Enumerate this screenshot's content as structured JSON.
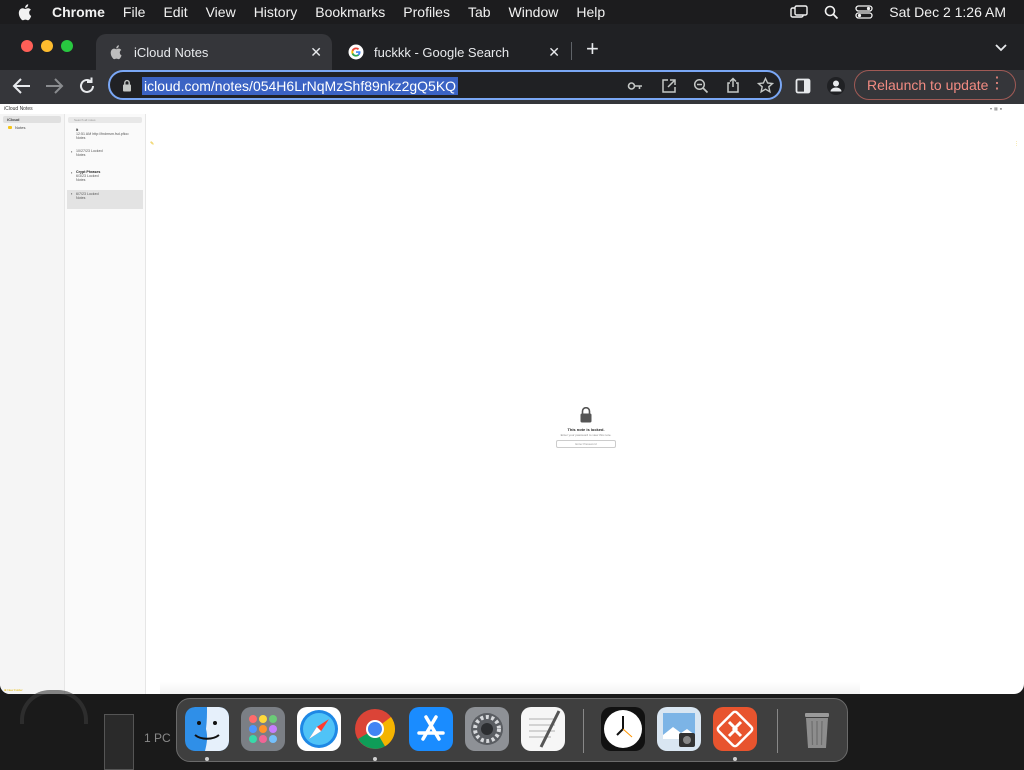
{
  "menubar": {
    "app_name": "Chrome",
    "items": [
      "File",
      "Edit",
      "View",
      "History",
      "Bookmarks",
      "Profiles",
      "Tab",
      "Window",
      "Help"
    ],
    "clock": "Sat Dec 2  1:26 AM"
  },
  "tabs": [
    {
      "title": "iCloud Notes",
      "active": true
    },
    {
      "title": "fuckkk - Google Search",
      "active": false
    }
  ],
  "toolbar": {
    "url": "icloud.com/notes/054H6LrNqMzShf89nkz2gQ5KQ",
    "relaunch_label": "Relaunch to update"
  },
  "notes": {
    "header": "iCloud Notes",
    "sidebar": {
      "account": "iCloud",
      "folder": "Notes"
    },
    "search_placeholder": "Search all notes",
    "list": [
      {
        "title": "It",
        "time": "12:51 AM",
        "preview": "http://fndmsm.fsd.pfioo",
        "folder": "Notes"
      },
      {
        "title": "",
        "time": "10/27/23",
        "preview": "Locked",
        "folder": "Notes"
      },
      {
        "title": "Crypt Phrases",
        "time": "6/3/23",
        "preview": "Locked",
        "folder": "Notes"
      },
      {
        "title": "",
        "time": "6/7/23",
        "preview": "Locked",
        "folder": "Notes",
        "selected": true
      }
    ],
    "locked": {
      "title": "This note is locked.",
      "subtitle": "Enter your password to view this note.",
      "password_placeholder": "Enter Password"
    }
  },
  "desktop": {
    "label": "1 PC"
  },
  "dock": {
    "apps": [
      "Finder",
      "Launchpad",
      "Safari",
      "Google Chrome",
      "App Store",
      "System Settings",
      "TextEdit",
      "Clock",
      "Preview",
      "Microsoft Remote Desktop",
      "Trash"
    ]
  }
}
